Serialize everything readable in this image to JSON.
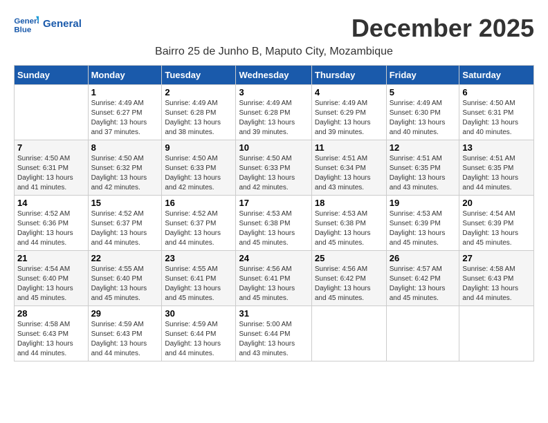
{
  "header": {
    "logo_line1": "General",
    "logo_line2": "Blue",
    "month_title": "December 2025",
    "location": "Bairro 25 de Junho B, Maputo City, Mozambique"
  },
  "weekdays": [
    "Sunday",
    "Monday",
    "Tuesday",
    "Wednesday",
    "Thursday",
    "Friday",
    "Saturday"
  ],
  "weeks": [
    [
      {
        "day": "",
        "info": ""
      },
      {
        "day": "1",
        "info": "Sunrise: 4:49 AM\nSunset: 6:27 PM\nDaylight: 13 hours\nand 37 minutes."
      },
      {
        "day": "2",
        "info": "Sunrise: 4:49 AM\nSunset: 6:28 PM\nDaylight: 13 hours\nand 38 minutes."
      },
      {
        "day": "3",
        "info": "Sunrise: 4:49 AM\nSunset: 6:28 PM\nDaylight: 13 hours\nand 39 minutes."
      },
      {
        "day": "4",
        "info": "Sunrise: 4:49 AM\nSunset: 6:29 PM\nDaylight: 13 hours\nand 39 minutes."
      },
      {
        "day": "5",
        "info": "Sunrise: 4:49 AM\nSunset: 6:30 PM\nDaylight: 13 hours\nand 40 minutes."
      },
      {
        "day": "6",
        "info": "Sunrise: 4:50 AM\nSunset: 6:31 PM\nDaylight: 13 hours\nand 40 minutes."
      }
    ],
    [
      {
        "day": "7",
        "info": "Sunrise: 4:50 AM\nSunset: 6:31 PM\nDaylight: 13 hours\nand 41 minutes."
      },
      {
        "day": "8",
        "info": "Sunrise: 4:50 AM\nSunset: 6:32 PM\nDaylight: 13 hours\nand 42 minutes."
      },
      {
        "day": "9",
        "info": "Sunrise: 4:50 AM\nSunset: 6:33 PM\nDaylight: 13 hours\nand 42 minutes."
      },
      {
        "day": "10",
        "info": "Sunrise: 4:50 AM\nSunset: 6:33 PM\nDaylight: 13 hours\nand 42 minutes."
      },
      {
        "day": "11",
        "info": "Sunrise: 4:51 AM\nSunset: 6:34 PM\nDaylight: 13 hours\nand 43 minutes."
      },
      {
        "day": "12",
        "info": "Sunrise: 4:51 AM\nSunset: 6:35 PM\nDaylight: 13 hours\nand 43 minutes."
      },
      {
        "day": "13",
        "info": "Sunrise: 4:51 AM\nSunset: 6:35 PM\nDaylight: 13 hours\nand 44 minutes."
      }
    ],
    [
      {
        "day": "14",
        "info": "Sunrise: 4:52 AM\nSunset: 6:36 PM\nDaylight: 13 hours\nand 44 minutes."
      },
      {
        "day": "15",
        "info": "Sunrise: 4:52 AM\nSunset: 6:37 PM\nDaylight: 13 hours\nand 44 minutes."
      },
      {
        "day": "16",
        "info": "Sunrise: 4:52 AM\nSunset: 6:37 PM\nDaylight: 13 hours\nand 44 minutes."
      },
      {
        "day": "17",
        "info": "Sunrise: 4:53 AM\nSunset: 6:38 PM\nDaylight: 13 hours\nand 45 minutes."
      },
      {
        "day": "18",
        "info": "Sunrise: 4:53 AM\nSunset: 6:38 PM\nDaylight: 13 hours\nand 45 minutes."
      },
      {
        "day": "19",
        "info": "Sunrise: 4:53 AM\nSunset: 6:39 PM\nDaylight: 13 hours\nand 45 minutes."
      },
      {
        "day": "20",
        "info": "Sunrise: 4:54 AM\nSunset: 6:39 PM\nDaylight: 13 hours\nand 45 minutes."
      }
    ],
    [
      {
        "day": "21",
        "info": "Sunrise: 4:54 AM\nSunset: 6:40 PM\nDaylight: 13 hours\nand 45 minutes."
      },
      {
        "day": "22",
        "info": "Sunrise: 4:55 AM\nSunset: 6:40 PM\nDaylight: 13 hours\nand 45 minutes."
      },
      {
        "day": "23",
        "info": "Sunrise: 4:55 AM\nSunset: 6:41 PM\nDaylight: 13 hours\nand 45 minutes."
      },
      {
        "day": "24",
        "info": "Sunrise: 4:56 AM\nSunset: 6:41 PM\nDaylight: 13 hours\nand 45 minutes."
      },
      {
        "day": "25",
        "info": "Sunrise: 4:56 AM\nSunset: 6:42 PM\nDaylight: 13 hours\nand 45 minutes."
      },
      {
        "day": "26",
        "info": "Sunrise: 4:57 AM\nSunset: 6:42 PM\nDaylight: 13 hours\nand 45 minutes."
      },
      {
        "day": "27",
        "info": "Sunrise: 4:58 AM\nSunset: 6:43 PM\nDaylight: 13 hours\nand 44 minutes."
      }
    ],
    [
      {
        "day": "28",
        "info": "Sunrise: 4:58 AM\nSunset: 6:43 PM\nDaylight: 13 hours\nand 44 minutes."
      },
      {
        "day": "29",
        "info": "Sunrise: 4:59 AM\nSunset: 6:43 PM\nDaylight: 13 hours\nand 44 minutes."
      },
      {
        "day": "30",
        "info": "Sunrise: 4:59 AM\nSunset: 6:44 PM\nDaylight: 13 hours\nand 44 minutes."
      },
      {
        "day": "31",
        "info": "Sunrise: 5:00 AM\nSunset: 6:44 PM\nDaylight: 13 hours\nand 43 minutes."
      },
      {
        "day": "",
        "info": ""
      },
      {
        "day": "",
        "info": ""
      },
      {
        "day": "",
        "info": ""
      }
    ]
  ]
}
